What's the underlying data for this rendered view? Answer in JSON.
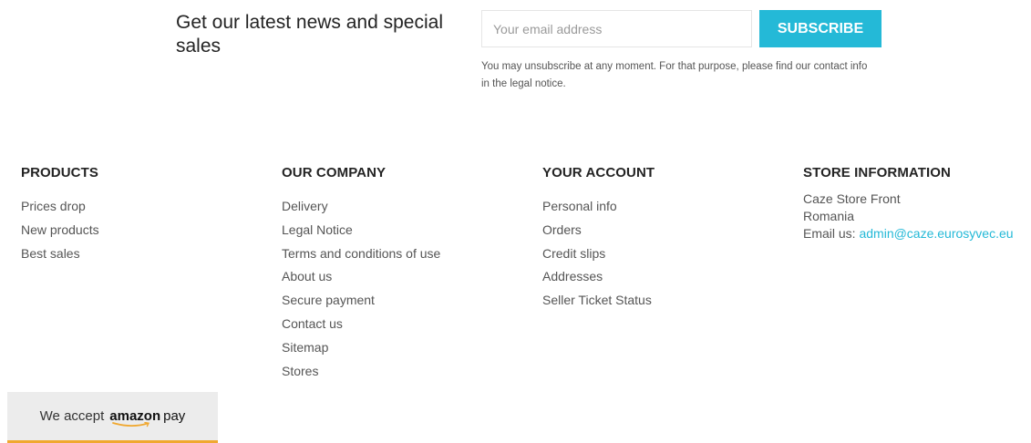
{
  "newsletter": {
    "heading": "Get our latest news and special sales",
    "email_placeholder": "Your email address",
    "subscribe_label": "SUBSCRIBE",
    "note": "You may unsubscribe at any moment. For that purpose, please find our contact info in the legal notice.",
    "accent_color": "#24b9d7"
  },
  "footer": {
    "products": {
      "title": "PRODUCTS",
      "items": [
        "Prices drop",
        "New products",
        "Best sales"
      ]
    },
    "company": {
      "title": "OUR COMPANY",
      "items": [
        "Delivery",
        "Legal Notice",
        "Terms and conditions of use",
        "About us",
        "Secure payment",
        "Contact us",
        "Sitemap",
        "Stores"
      ]
    },
    "account": {
      "title": "YOUR ACCOUNT",
      "items": [
        "Personal info",
        "Orders",
        "Credit slips",
        "Addresses",
        "Seller Ticket Status"
      ]
    },
    "store": {
      "title": "STORE INFORMATION",
      "name": "Caze Store Front",
      "country": "Romania",
      "email_label": "Email us: ",
      "email": "admin@caze.eurosyvec.eu"
    }
  },
  "payment_badge": {
    "prefix": "We accept",
    "brand": "amazon",
    "suffix": "pay",
    "accent_color": "#f0a830"
  }
}
